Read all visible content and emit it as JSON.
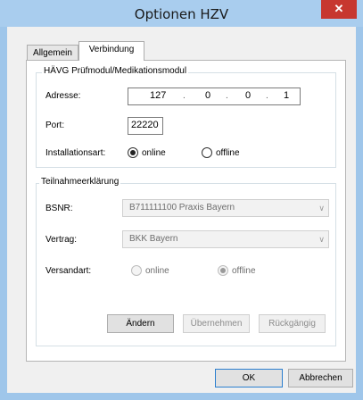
{
  "window": {
    "title": "Optionen HZV",
    "close_glyph": "✕"
  },
  "tabs": [
    {
      "label": "Allgemein",
      "active": false
    },
    {
      "label": "Verbindung",
      "active": true
    }
  ],
  "module_group": {
    "title": "HÄVG Prüfmodul/Medikationsmodul",
    "address_label": "Adresse:",
    "address_octets": [
      "127",
      "0",
      "0",
      "1"
    ],
    "address_separator": ".",
    "port_label": "Port:",
    "port_value": "22220",
    "install_label": "Installationsart:",
    "install_options": [
      {
        "label": "online",
        "checked": true
      },
      {
        "label": "offline",
        "checked": false
      }
    ]
  },
  "participant_group": {
    "title": "Teilnahmeerklärung",
    "bsnr_label": "BSNR:",
    "bsnr_value": "B711111100 Praxis Bayern",
    "contract_label": "Vertrag:",
    "contract_value": "BKK Bayern",
    "shipping_label": "Versandart:",
    "shipping_options": [
      {
        "label": "online",
        "checked": false
      },
      {
        "label": "offline",
        "checked": true
      }
    ],
    "buttons": {
      "change": "Ändern",
      "apply": "Übernehmen",
      "undo": "Rückgängig"
    }
  },
  "dialog_buttons": {
    "ok": "OK",
    "cancel": "Abbrechen"
  },
  "colors": {
    "titlebar": "#a9cdee",
    "close": "#c7372f",
    "default_border": "#2b7fcf"
  },
  "icons": {
    "close": "close-icon",
    "dropdown": "chevron-down-icon"
  }
}
